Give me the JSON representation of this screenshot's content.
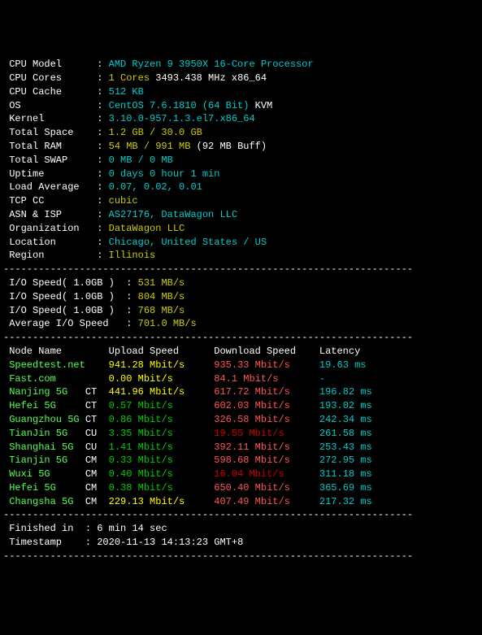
{
  "sysinfo": [
    {
      "label": "CPU Model",
      "value": "AMD Ryzen 9 3950X 16-Core Processor",
      "color": "cyan"
    },
    {
      "label": "CPU Cores",
      "value": "1 Cores",
      "color": "yellow",
      "extra": " 3493.438 MHz x86_64"
    },
    {
      "label": "CPU Cache",
      "value": "512 KB",
      "color": "cyan"
    },
    {
      "label": "OS",
      "value": "CentOS 7.6.1810 (64 Bit)",
      "color": "cyan",
      "extra": " KVM"
    },
    {
      "label": "Kernel",
      "value": "3.10.0-957.1.3.el7.x86_64",
      "color": "cyan"
    },
    {
      "label": "Total Space",
      "value": "1.2 GB / 30.0 GB",
      "color": "yellow"
    },
    {
      "label": "Total RAM",
      "value": "54 MB / 991 MB",
      "color": "yellow",
      "extra": " (92 MB Buff)"
    },
    {
      "label": "Total SWAP",
      "value": "0 MB / 0 MB",
      "color": "cyan"
    },
    {
      "label": "Uptime",
      "value": "0 days 0 hour 1 min",
      "color": "cyan"
    },
    {
      "label": "Load Average",
      "value": "0.07, 0.02, 0.01",
      "color": "cyan"
    },
    {
      "label": "TCP CC",
      "value": "cubic",
      "color": "yellow"
    },
    {
      "label": "ASN & ISP",
      "value": "AS27176, DataWagon LLC",
      "color": "cyan"
    },
    {
      "label": "Organization",
      "value": "DataWagon LLC",
      "color": "yellow"
    },
    {
      "label": "Location",
      "value": "Chicago, United States / US",
      "color": "cyan"
    },
    {
      "label": "Region",
      "value": "Illinois",
      "color": "yellow"
    }
  ],
  "io": [
    {
      "label": "I/O Speed( 1.0GB )",
      "value": "531 MB/s",
      "color": "yellow"
    },
    {
      "label": "I/O Speed( 1.0GB )",
      "value": "804 MB/s",
      "color": "yellow"
    },
    {
      "label": "I/O Speed( 1.0GB )",
      "value": "768 MB/s",
      "color": "yellow"
    },
    {
      "label": "Average I/O Speed",
      "value": "701.0 MB/s",
      "color": "yellow"
    }
  ],
  "speedtest": {
    "headers": {
      "node": "Node Name",
      "upload": "Upload Speed",
      "download": "Download Speed",
      "latency": "Latency"
    },
    "rows": [
      {
        "name": "Speedtest.net",
        "name_color": "bright-green",
        "tag": "",
        "upload": "941.28 Mbit/s",
        "upload_color": "bright-yellow",
        "download": "935.33 Mbit/s",
        "download_color": "red",
        "latency": "19.63 ms"
      },
      {
        "name": "Fast.com",
        "name_color": "bright-green",
        "tag": "",
        "upload": "0.00 Mbit/s",
        "upload_color": "bright-yellow",
        "download": "84.1 Mbit/s",
        "download_color": "red",
        "latency": "-"
      },
      {
        "name": "Nanjing 5G",
        "name_color": "bright-green",
        "tag": "CT",
        "upload": "441.96 Mbit/s",
        "upload_color": "bright-yellow",
        "download": "617.72 Mbit/s",
        "download_color": "red",
        "latency": "196.82 ms"
      },
      {
        "name": "Hefei 5G",
        "name_color": "bright-green",
        "tag": "CT",
        "upload": "0.57 Mbit/s",
        "upload_color": "green",
        "download": "602.03 Mbit/s",
        "download_color": "red",
        "latency": "193.02 ms"
      },
      {
        "name": "Guangzhou 5G",
        "name_color": "bright-green",
        "tag": "CT",
        "upload": "0.86 Mbit/s",
        "upload_color": "green",
        "download": "326.58 Mbit/s",
        "download_color": "red",
        "latency": "242.34 ms"
      },
      {
        "name": "TianJin 5G",
        "name_color": "bright-green",
        "tag": "CU",
        "upload": "3.35 Mbit/s",
        "upload_color": "green",
        "download": "19.55 Mbit/s",
        "download_color": "dark-red",
        "latency": "261.58 ms"
      },
      {
        "name": "Shanghai 5G",
        "name_color": "bright-green",
        "tag": "CU",
        "upload": "1.41 Mbit/s",
        "upload_color": "green",
        "download": "392.11 Mbit/s",
        "download_color": "red",
        "latency": "253.43 ms"
      },
      {
        "name": "Tianjin 5G",
        "name_color": "bright-green",
        "tag": "CM",
        "upload": "0.33 Mbit/s",
        "upload_color": "green",
        "download": "598.68 Mbit/s",
        "download_color": "red",
        "latency": "272.95 ms"
      },
      {
        "name": "Wuxi 5G",
        "name_color": "bright-green",
        "tag": "CM",
        "upload": "0.40 Mbit/s",
        "upload_color": "green",
        "download": "16.04 Mbit/s",
        "download_color": "dark-red",
        "latency": "311.18 ms"
      },
      {
        "name": "Hefei 5G",
        "name_color": "bright-green",
        "tag": "CM",
        "upload": "0.38 Mbit/s",
        "upload_color": "green",
        "download": "650.40 Mbit/s",
        "download_color": "red",
        "latency": "365.69 ms"
      },
      {
        "name": "Changsha 5G",
        "name_color": "bright-green",
        "tag": "CM",
        "upload": "229.13 Mbit/s",
        "upload_color": "bright-yellow",
        "download": "407.49 Mbit/s",
        "download_color": "red",
        "latency": "217.32 ms"
      }
    ]
  },
  "footer": [
    {
      "label": "Finished in",
      "value": "6 min 14 sec"
    },
    {
      "label": "Timestamp",
      "value": "2020-11-13 14:13:23 GMT+8"
    }
  ],
  "divider": "----------------------------------------------------------------------"
}
